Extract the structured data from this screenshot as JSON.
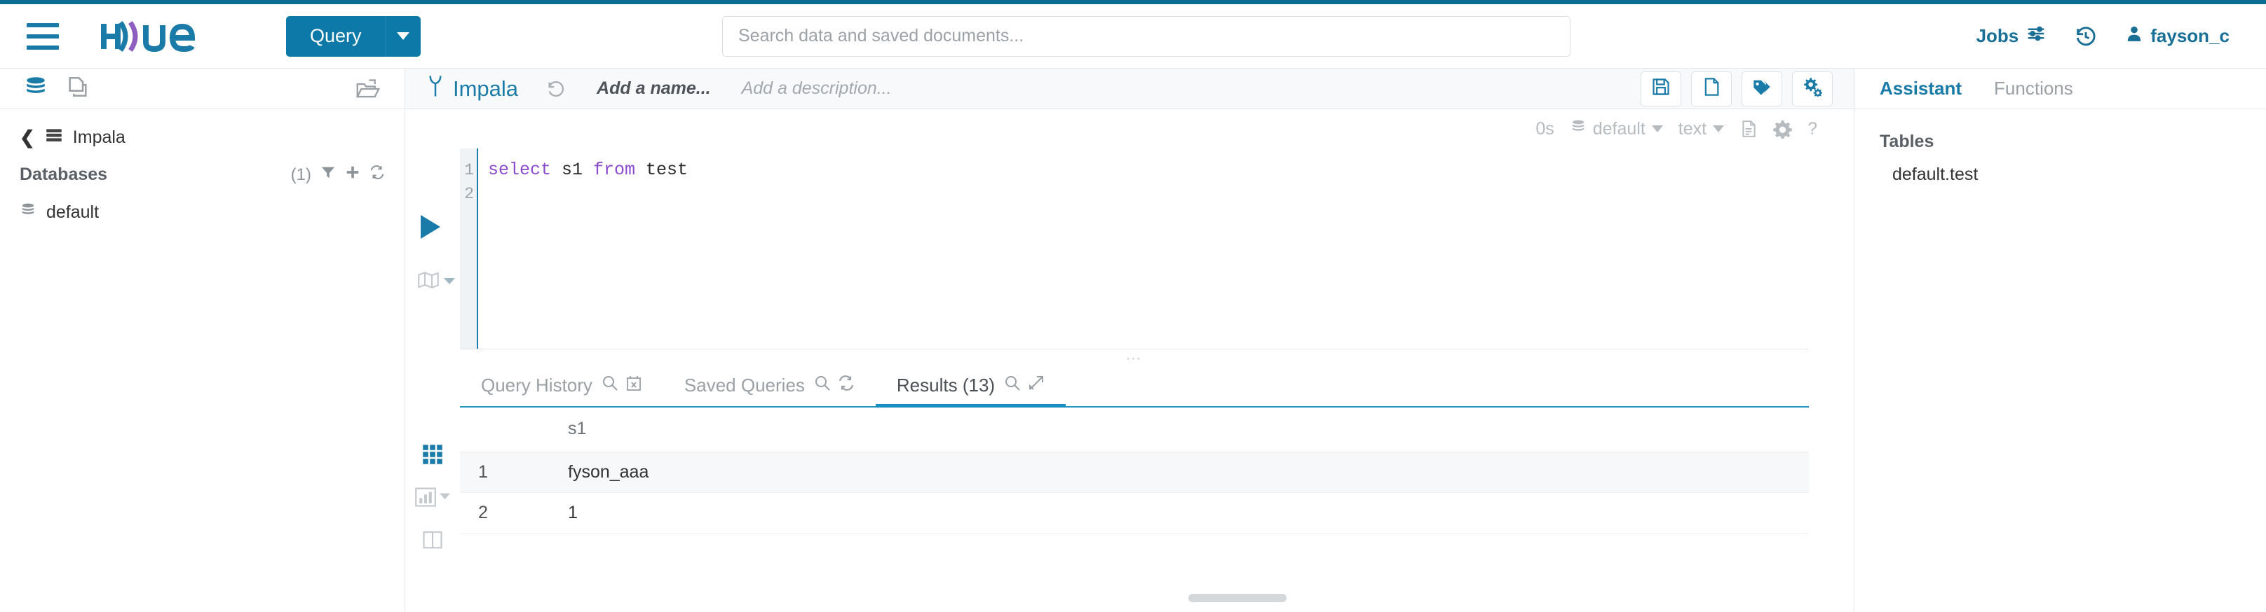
{
  "header": {
    "menu_icon": "hamburger-menu-icon",
    "logo_text": "hue",
    "query_button_label": "Query",
    "query_dropdown_icon": "chevron-down-icon",
    "search": {
      "placeholder": "Search data and saved documents...",
      "value": ""
    },
    "jobs_label": "Jobs",
    "jobs_icon": "sliders-icon",
    "history_icon": "history-clock-icon",
    "user_icon": "user-icon",
    "username": "fayson_c"
  },
  "sidebar": {
    "top_icons": [
      "database-stack-icon",
      "documents-icon",
      "open-folder-icon"
    ],
    "breadcrumb_back_icon": "chevron-left-icon",
    "breadcrumb_source_icon": "server-rack-icon",
    "breadcrumb_label": "Impala",
    "databases_title": "Databases",
    "databases_count": "(1)",
    "tool_icons": [
      "filter-icon",
      "plus-icon",
      "refresh-icon"
    ],
    "databases": [
      {
        "icon": "database-icon",
        "label": "default"
      }
    ]
  },
  "editor": {
    "engine_icon": "impala-icon",
    "engine_label": "Impala",
    "revert_icon": "revert-history-icon",
    "name_placeholder": "Add a name...",
    "description_placeholder": "Add a description...",
    "actions": [
      {
        "name": "save-button",
        "icon": "floppy-disk-icon"
      },
      {
        "name": "new-document-button",
        "icon": "document-icon"
      },
      {
        "name": "tags-button",
        "icon": "tags-icon"
      },
      {
        "name": "settings-button",
        "icon": "gears-icon"
      }
    ],
    "meta": {
      "elapsed": "0s",
      "database_icon": "database-icon",
      "database": "default",
      "format": "text",
      "log_icon": "log-document-icon",
      "settings_icon": "gear-icon",
      "help_icon": "help-icon",
      "help_label": "?"
    },
    "run_button_icon": "play-triangle-icon",
    "explain_icon": "explain-map-icon",
    "explain_caret_icon": "caret-down-icon",
    "line_numbers": [
      "1",
      "2"
    ],
    "query_tokens": [
      {
        "text": "select",
        "type": "keyword"
      },
      {
        "text": " s1 ",
        "type": "identifier"
      },
      {
        "text": "from",
        "type": "keyword"
      },
      {
        "text": " test",
        "type": "identifier"
      }
    ],
    "query_text": "select s1 from test",
    "splitter_icon": "resize-handle-dots"
  },
  "result_tabs": [
    {
      "label": "Query History",
      "active": false,
      "icons": [
        "search-icon",
        "calendar-clear-icon"
      ]
    },
    {
      "label": "Saved Queries",
      "active": false,
      "icons": [
        "search-icon",
        "refresh-icon"
      ]
    },
    {
      "label": "Results (13)",
      "active": true,
      "icons": [
        "search-icon",
        "expand-arrows-icon"
      ]
    }
  ],
  "results": {
    "view_icons": [
      {
        "name": "grid-view-icon",
        "active": true
      },
      {
        "name": "chart-view-icon",
        "active": false
      },
      {
        "name": "columns-view-icon",
        "active": false
      }
    ],
    "columns": [
      "s1"
    ],
    "rows": [
      {
        "num": "1",
        "values": [
          "fyson_aaa"
        ]
      },
      {
        "num": "2",
        "values": [
          "1"
        ]
      }
    ],
    "scrollbar": "horizontal-scrollbar"
  },
  "assistant": {
    "tabs": [
      {
        "label": "Assistant",
        "active": true
      },
      {
        "label": "Functions",
        "active": false
      }
    ],
    "tables_title": "Tables",
    "tables": [
      "default.test"
    ]
  },
  "colors": {
    "accent": "#0c6e93",
    "brand_blue": "#1a7ba8",
    "button_blue": "#0c79a8",
    "tab_underline": "#1a8fc4",
    "keyword_purple": "#8a4ccf",
    "muted_text": "#9aa0a5"
  }
}
